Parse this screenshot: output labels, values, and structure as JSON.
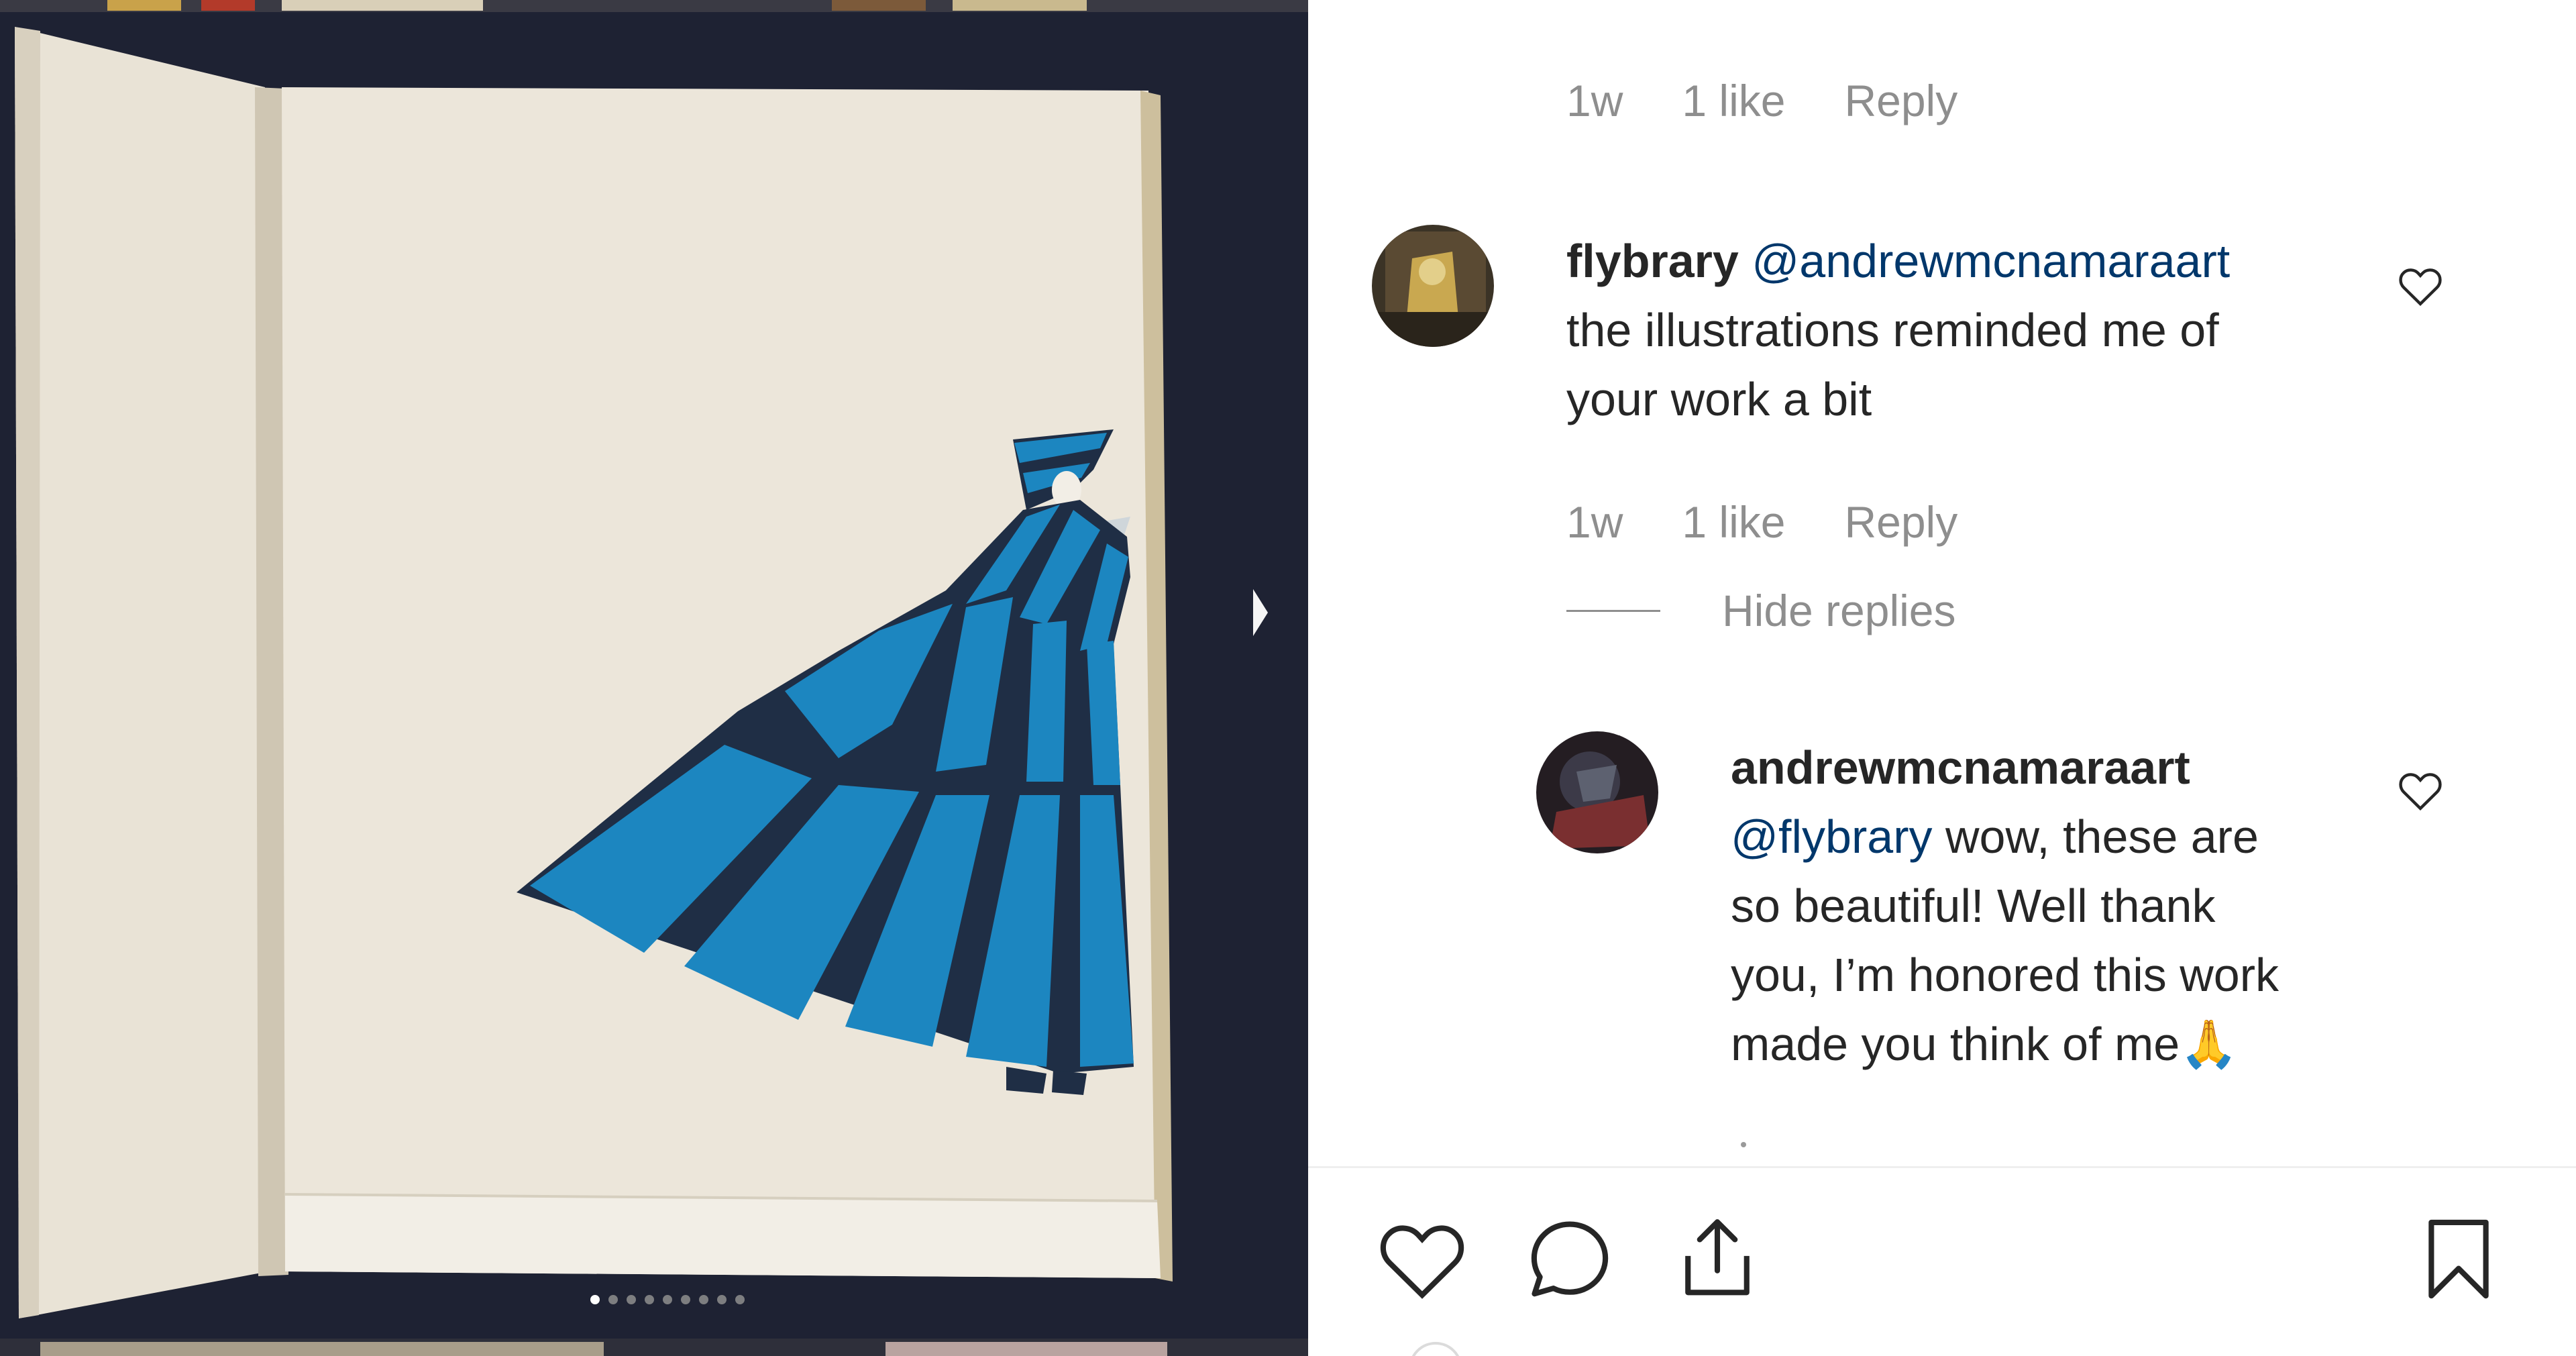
{
  "carousel": {
    "slide_count": 9,
    "active_index": 0
  },
  "comments": {
    "first_meta": {
      "age": "1w",
      "likes": "1 like",
      "reply": "Reply"
    },
    "flybrary": {
      "username": "flybrary",
      "mention": "@andrewmcnamaraart",
      "line1_rest": "",
      "line2": "the illustrations reminded me of",
      "line3": "your work a bit",
      "age": "1w",
      "likes": "1 like",
      "reply": "Reply"
    },
    "hide_replies": "Hide replies",
    "reply": {
      "username": "andrewmcnamaraart",
      "mention": "@flybrary",
      "line1_rest": " wow, these are",
      "line2": "so beautiful! Well thank",
      "line3": "you, I’m honored this work",
      "line4": "made you think of me",
      "emoji": "🙏"
    }
  },
  "icons": {
    "like": "heart-icon",
    "comment": "comment-icon",
    "share": "share-icon",
    "save": "bookmark-icon"
  },
  "colors": {
    "text": "#262626",
    "secondary_text": "#8e8e8e",
    "mention": "#00376b",
    "backdrop": "#1e2233",
    "paper": "#ece6da",
    "illustration_blue": "#1c86c0",
    "illustration_dark": "#1f2e45"
  }
}
